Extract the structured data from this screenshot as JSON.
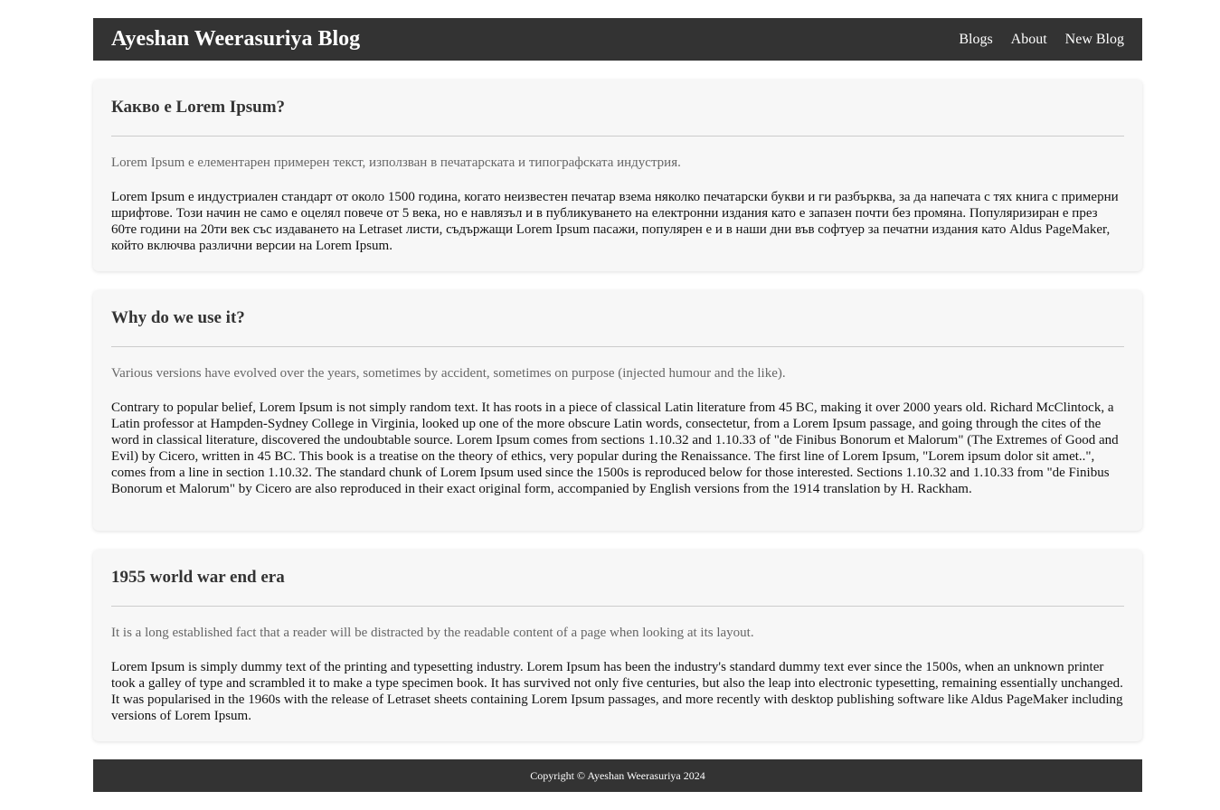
{
  "header": {
    "brand": "Ayeshan Weerasuriya Blog",
    "nav": [
      "Blogs",
      "About",
      "New Blog"
    ]
  },
  "posts": [
    {
      "title": "Какво е Lorem Ipsum?",
      "snippet": "Lorem Ipsum е елементарен примерен текст, използван в печатарската и типографската индустрия.",
      "body": "Lorem Ipsum е индустриален стандарт от около 1500 година, когато неизвестен печатар взема няколко печатарски букви и ги разбърква, за да напечата с тях книга с примерни шрифтове. Този начин не само е оцелял повече от 5 века, но е навлязъл и в публикуването на електронни издания като е запазен почти без промяна. Популяризиран е през 60те години на 20ти век със издаването на Letraset листи, съдържащи Lorem Ipsum пасажи, популярен е и в наши дни във софтуер за печатни издания като Aldus PageMaker, който включва различни версии на Lorem Ipsum."
    },
    {
      "title": "Why do we use it?",
      "snippet": "Various versions have evolved over the years, sometimes by accident, sometimes on purpose (injected humour and the like).",
      "body": "Contrary to popular belief, Lorem Ipsum is not simply random text. It has roots in a piece of classical Latin literature from 45 BC, making it over 2000 years old. Richard McClintock, a Latin professor at Hampden-Sydney College in Virginia, looked up one of the more obscure Latin words, consectetur, from a Lorem Ipsum passage, and going through the cites of the word in classical literature, discovered the undoubtable source. Lorem Ipsum comes from sections 1.10.32 and 1.10.33 of \"de Finibus Bonorum et Malorum\" (The Extremes of Good and Evil) by Cicero, written in 45 BC. This book is a treatise on the theory of ethics, very popular during the Renaissance. The first line of Lorem Ipsum, \"Lorem ipsum dolor sit amet..\", comes from a line in section 1.10.32. The standard chunk of Lorem Ipsum used since the 1500s is reproduced below for those interested. Sections 1.10.32 and 1.10.33 from \"de Finibus Bonorum et Malorum\" by Cicero are also reproduced in their exact original form, accompanied by English versions from the 1914 translation by H. Rackham."
    },
    {
      "title": "1955 world war end era",
      "snippet": "It is a long established fact that a reader will be distracted by the readable content of a page when looking at its layout.",
      "body": "Lorem Ipsum is simply dummy text of the printing and typesetting industry. Lorem Ipsum has been the industry's standard dummy text ever since the 1500s, when an unknown printer took a galley of type and scrambled it to make a type specimen book. It has survived not only five centuries, but also the leap into electronic typesetting, remaining essentially unchanged. It was popularised in the 1960s with the release of Letraset sheets containing Lorem Ipsum passages, and more recently with desktop publishing software like Aldus PageMaker including versions of Lorem Ipsum."
    }
  ],
  "footer": {
    "copyright": "Copyright © Ayeshan Weerasuriya 2024"
  },
  "colors": {
    "header_bg": "#333333",
    "card_bg": "#f7f7f7",
    "snippet_text": "#666666"
  }
}
